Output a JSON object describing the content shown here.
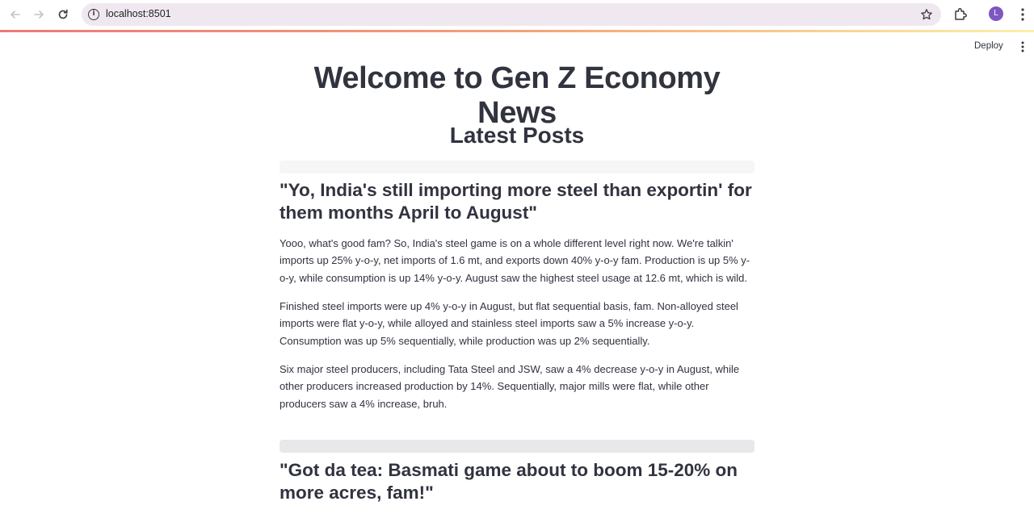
{
  "browser": {
    "url": "localhost:8501",
    "profile_initial": "L"
  },
  "toolbar": {
    "deploy_label": "Deploy"
  },
  "page": {
    "title": "Welcome to Gen Z Economy News",
    "section_title": "Latest Posts"
  },
  "posts": [
    {
      "title": "\"Yo, India's still importing more steel than exportin' for them months April to August\"",
      "paragraphs": [
        "Yooo, what's good fam? So, India's steel game is on a whole different level right now. We're talkin' imports up 25% y-o-y, net imports of 1.6 mt, and exports down 40% y-o-y fam. Production is up 5% y-o-y, while consumption is up 14% y-o-y. August saw the highest steel usage at 12.6 mt, which is wild.",
        "Finished steel imports were up 4% y-o-y in August, but flat sequential basis, fam. Non-alloyed steel imports were flat y-o-y, while alloyed and stainless steel imports saw a 5% increase y-o-y. Consumption was up 5% sequentially, while production was up 2% sequentially.",
        "Six major steel producers, including Tata Steel and JSW, saw a 4% decrease y-o-y in August, while other producers increased production by 14%. Sequentially, major mills were flat, while other producers saw a 4% increase, bruh."
      ]
    },
    {
      "title": "\"Got da tea: Basmati game about to boom 15-20% on more acres, fam!\"",
      "paragraphs": []
    }
  ]
}
